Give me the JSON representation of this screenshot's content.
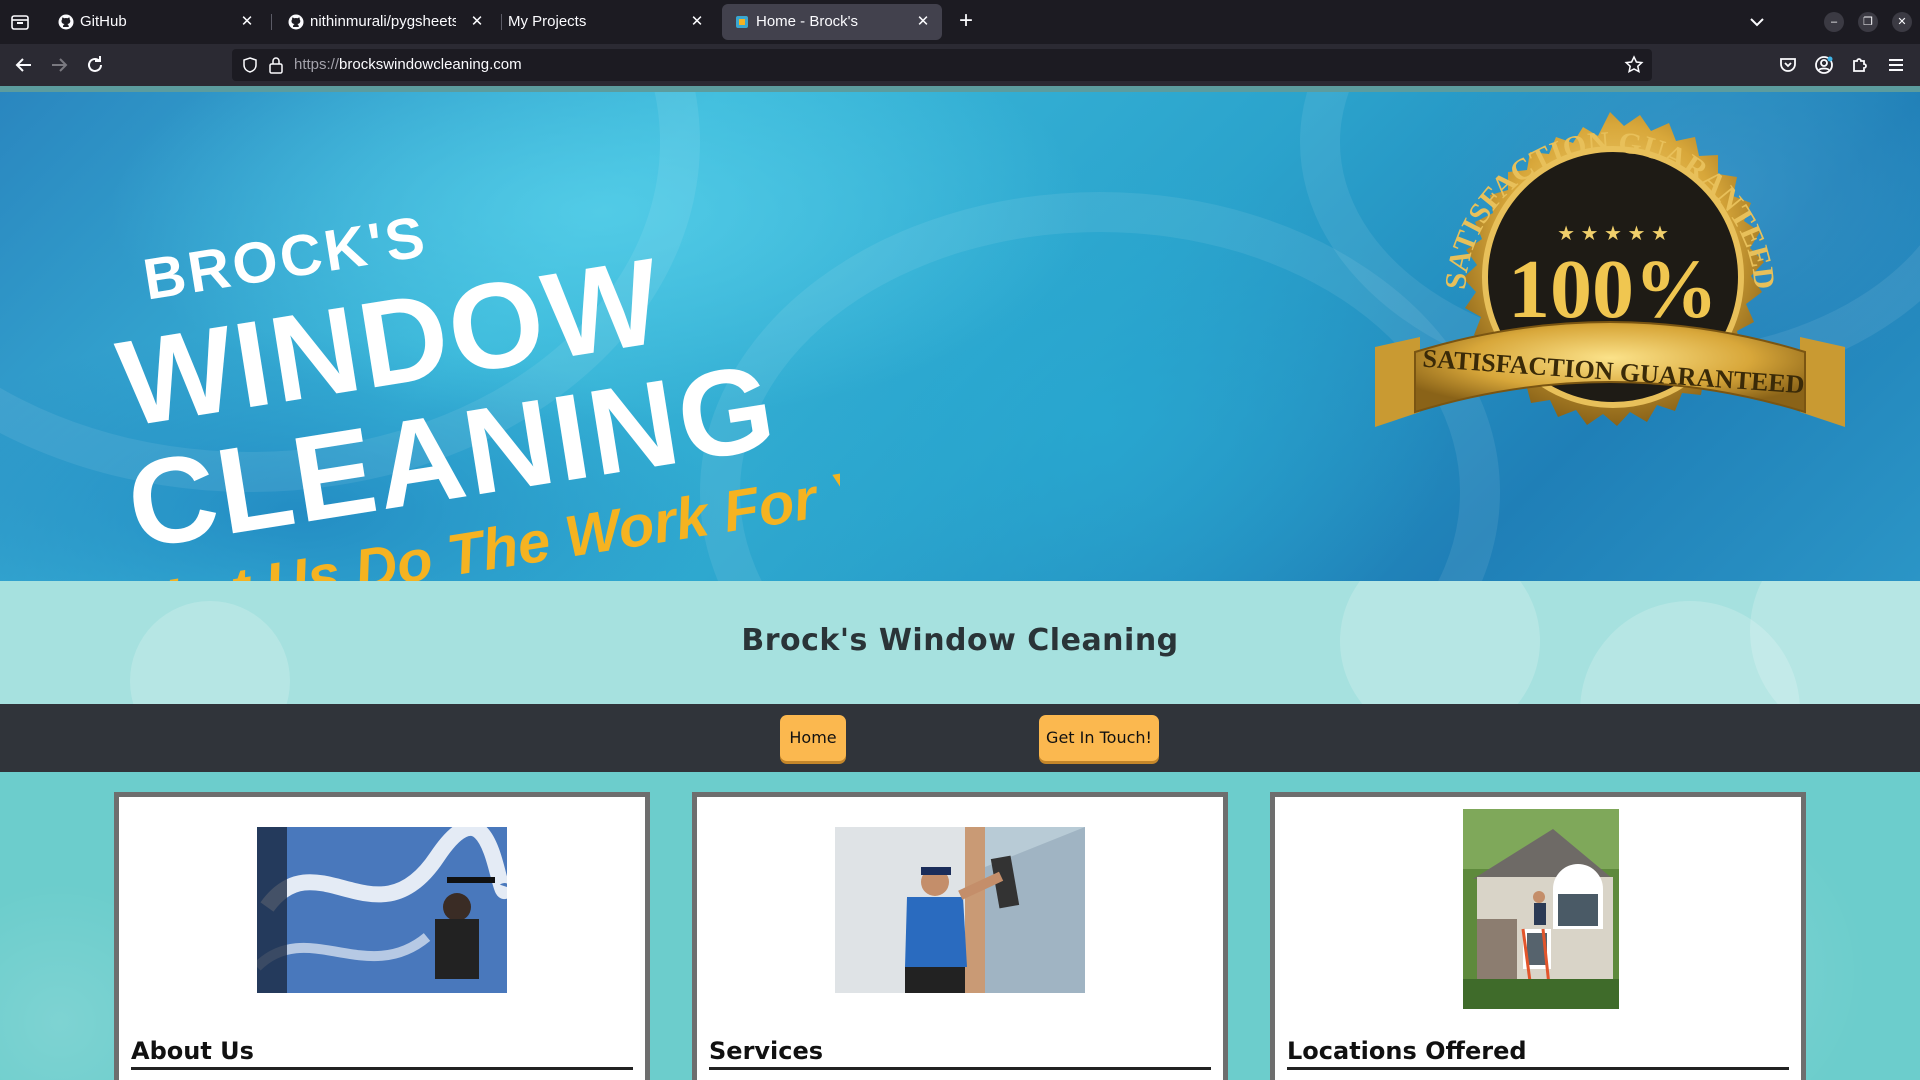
{
  "browser": {
    "tabs": [
      {
        "title": "GitHub",
        "icon": "github-icon",
        "active": false
      },
      {
        "title": "nithinmurali/pygsheets: G",
        "icon": "github-icon",
        "active": false
      },
      {
        "title": "My Projects",
        "icon": "",
        "active": false
      },
      {
        "title": "Home - Brock's",
        "icon": "site-favicon",
        "active": true
      }
    ],
    "url_scheme": "https://",
    "url_host": "brockswindowcleaning.com"
  },
  "hero": {
    "logo_line1": "BROCK'S",
    "logo_line2": "WINDOW",
    "logo_line3": "CLEANING",
    "tagline": "Let Us Do The Work For You!",
    "seal_arc_text": "SATISFACTION GUARANTEED",
    "seal_percent": "100%",
    "seal_ribbon_text": "SATISFACTION GUARANTEED",
    "seal_stars": "★ ★ ★ ★ ★"
  },
  "site": {
    "title": "Brock's Window Cleaning"
  },
  "menu": {
    "home": "Home",
    "contact": "Get In Touch!"
  },
  "cards": [
    {
      "heading": "About Us"
    },
    {
      "heading": "Services"
    },
    {
      "heading": "Locations Offered"
    }
  ],
  "colors": {
    "accent_button": "#fbb84f",
    "menu_bar": "#30343a",
    "title_band": "#a6e1df",
    "page_background": "#6ccdcc",
    "logo_text": "#ffffff",
    "tagline": "#f5b321"
  }
}
